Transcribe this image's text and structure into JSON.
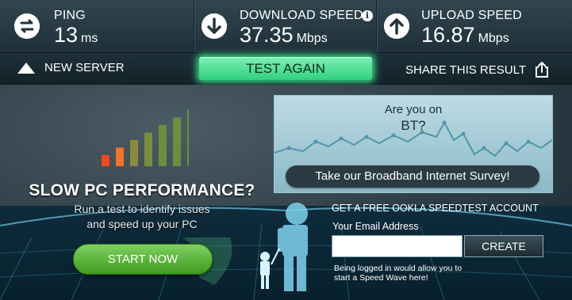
{
  "header": {
    "ping": {
      "label": "PING",
      "value": "13",
      "unit": "ms",
      "icon": "ping-arrows-icon"
    },
    "download": {
      "label": "DOWNLOAD SPEED",
      "value": "37.35",
      "unit": "Mbps",
      "icon": "download-arrow-icon",
      "info_icon": "i"
    },
    "upload": {
      "label": "UPLOAD SPEED",
      "value": "16.87",
      "unit": "Mbps",
      "icon": "upload-arrow-icon"
    }
  },
  "actions": {
    "new_server": "NEW SERVER",
    "test_again": "TEST AGAIN",
    "share": "SHARE THIS RESULT"
  },
  "promo": {
    "title": "SLOW PC PERFORMANCE?",
    "line1": "Run a test to identify issues",
    "line2": "and speed up your PC",
    "button": "START NOW",
    "signal_bars": [
      {
        "color": "#f04a1e"
      },
      {
        "color": "#f37427"
      },
      {
        "color": "#8d8a3a"
      },
      {
        "color": "#7b8e3d"
      },
      {
        "color": "#6f8e3c"
      },
      {
        "color": "#6a903c"
      },
      {
        "color": "#66913c"
      }
    ]
  },
  "survey": {
    "question_line1": "Are you on",
    "question_line2": "BT?",
    "button": "Take our Broadband Internet Survey!"
  },
  "account": {
    "title": "GET A FREE OOKLA SPEEDTEST ACCOUNT",
    "email_label": "Your Email Address",
    "email_value": "",
    "create_button": "CREATE",
    "note_line1": "Being logged in would allow you to",
    "note_line2": "start a Speed Wave here!"
  },
  "colors": {
    "accent_green": "#3ae08a",
    "start_green": "#5bb53a",
    "survey_blue": "#a9cfd9"
  }
}
